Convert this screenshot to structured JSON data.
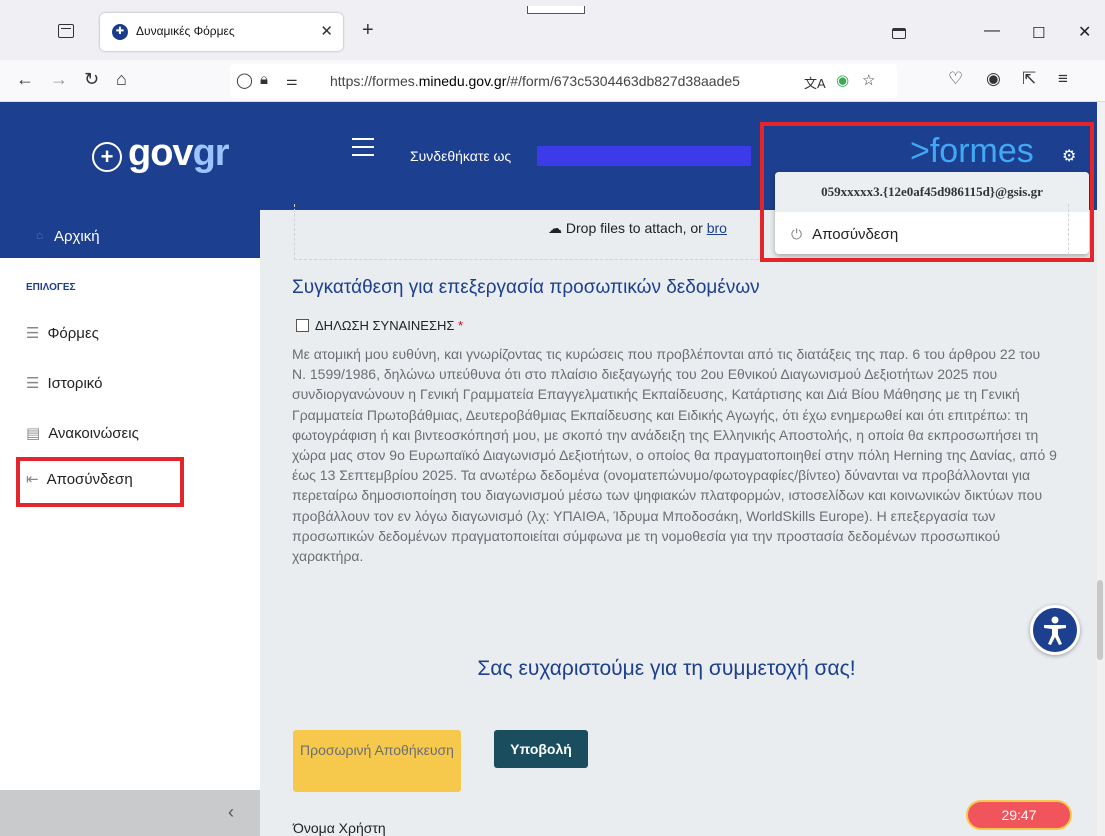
{
  "browser": {
    "tab_title": "Δυναμικές Φόρμες",
    "url_prefix": "https://formes.",
    "url_domain": "minedu.gov.gr",
    "url_suffix": "/#/form/673c5304463db827d38aade5"
  },
  "header": {
    "logo_main": "gov",
    "logo_accent": "gr",
    "logged_in_label": "Συνδεθήκατε ως",
    "brand": ">formes"
  },
  "user_menu": {
    "email": "059xxxxx3.{12e0af45d986115d}@gsis.gr",
    "logout": "Αποσύνδεση"
  },
  "sidebar": {
    "home": "Αρχική",
    "section": "ΕΠΙΛΟΓΕΣ",
    "items": [
      {
        "label": "Φόρμες",
        "icon": "list-icon"
      },
      {
        "label": "Ιστορικό",
        "icon": "list-icon"
      },
      {
        "label": "Ανακοινώσεις",
        "icon": "book-icon"
      },
      {
        "label": "Αποσύνδεση",
        "icon": "logout-icon"
      }
    ]
  },
  "main": {
    "drop_text": "Drop files to attach, or ",
    "drop_link": "bro",
    "section_title": "Συγκατάθεση για επεξεργασία προσωπικών δεδομένων",
    "consent_label": "ΔΗΛΩΣΗ ΣΥΝΑΙΝΕΣΗΣ",
    "required_mark": "*",
    "consent_text": "Με ατομική μου ευθύνη, και γνωρίζοντας τις κυρώσεις που προβλέπονται από τις διατάξεις της παρ. 6 του άρθρου 22 του Ν. 1599/1986, δηλώνω υπεύθυνα ότι στο πλαίσιο διεξαγωγής του 2ου Εθνικού Διαγωνισμού Δεξιοτήτων 2025 που συνδιοργανώνουν η Γενική Γραμματεία Επαγγελματικής Εκπαίδευσης, Κατάρτισης και Διά Βίου Μάθησης με τη Γενική Γραμματεία Πρωτοβάθμιας, Δευτεροβάθμιας Εκπαίδευσης και Ειδικής Αγωγής, ότι έχω ενημερωθεί και ότι επιτρέπω: τη φωτογράφιση ή και βιντεοσκόπησή μου, με σκοπό την ανάδειξη της Ελληνικής Αποστολής, η οποία θα εκπροσωπήσει τη χώρα μας στον 9ο Ευρωπαϊκό Διαγωνισμό Δεξιοτήτων, ο οποίος θα πραγματοποιηθεί στην πόλη Herning της Δανίας, από 9 έως 13 Σεπτεμβρίου 2025. Τα ανωτέρω δεδομένα (ονοματεπώνυμο/φωτογραφίες/βίντεο) δύνανται να προβάλλονται για περεταίρω δημοσιοποίηση του διαγωνισμού μέσω των ψηφιακών πλατφορμών, ιστοσελίδων και κοινωνικών δικτύων που προβάλλουν τον εν λόγω διαγωνισμό (λχ: ΥΠΑΙΘΑ, Ίδρυμα Μποδοσάκη, WorldSkills Europe). Η επεξεργασία των προσωπικών δεδομένων πραγματοποιείται σύμφωνα με τη νομοθεσία για την προστασία δεδομένων προσωπικού χαρακτήρα.",
    "thanks": "Σας ευχαριστούμε για τη συμμετοχή σας!",
    "save_button": "Προσωρινή Αποθήκευση",
    "submit_button": "Υποβολή",
    "username_label": "Όνομα Χρήστη",
    "timer": "29:47"
  },
  "colors": {
    "header_blue": "#1d3f8f",
    "highlight_red": "#e3262c",
    "save_yellow": "#f6c94c",
    "submit_teal": "#1a4e5f"
  }
}
